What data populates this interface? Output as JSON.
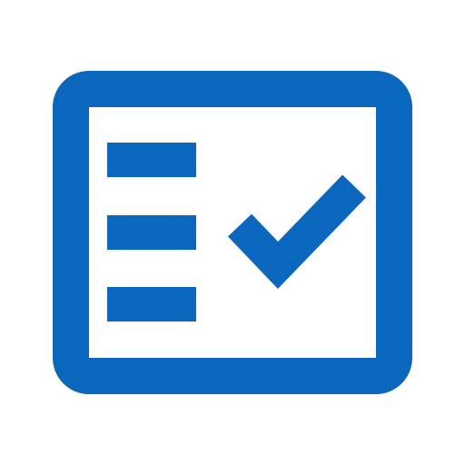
{
  "icon": {
    "name": "checklist-icon",
    "color": "#0B67BE",
    "background": "#ffffff",
    "list_line_count": 3,
    "has_checkmark": true
  }
}
